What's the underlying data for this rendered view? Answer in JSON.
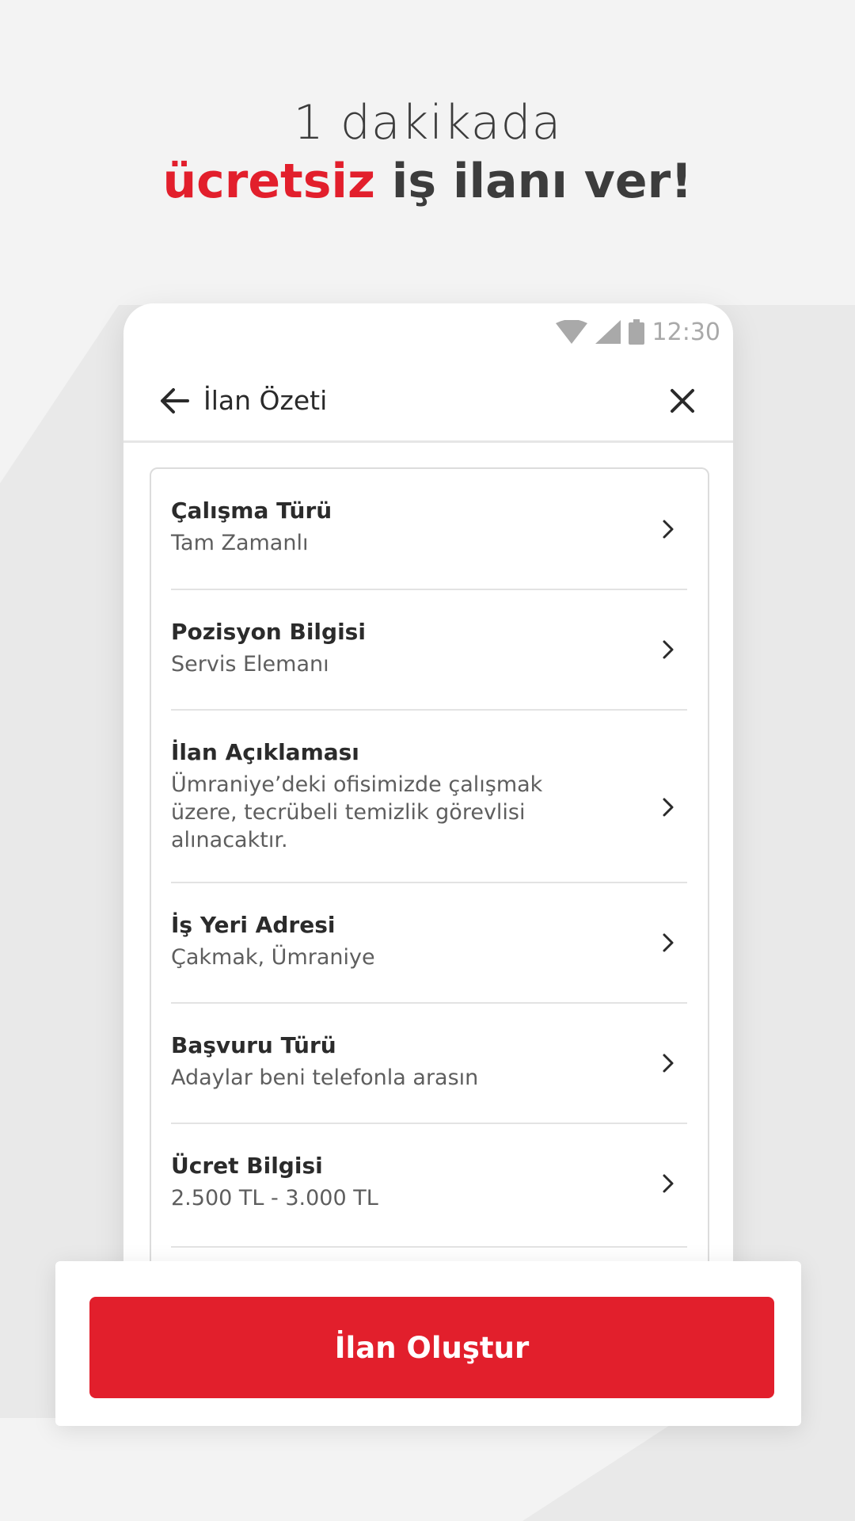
{
  "headline": {
    "line1": "1 dakikada",
    "line2_accent": "ücretsiz",
    "line2_rest": " iş ilanı ver!"
  },
  "statusbar": {
    "time": "12:30"
  },
  "appbar": {
    "title": "İlan Özeti"
  },
  "rows": [
    {
      "label": "Çalışma Türü",
      "value": "Tam Zamanlı"
    },
    {
      "label": "Pozisyon Bilgisi",
      "value": "Servis Elemanı"
    },
    {
      "label": "İlan Açıklaması",
      "value": "Ümraniye’deki ofisimizde çalışmak üzere, tecrübeli temizlik görevlisi alınacaktır."
    },
    {
      "label": "İş Yeri Adresi",
      "value": "Çakmak, Ümraniye"
    },
    {
      "label": "Başvuru Türü",
      "value": "Adaylar beni telefonla arasın"
    },
    {
      "label": "Ücret Bilgisi",
      "value": "2.500 TL - 3.000 TL"
    }
  ],
  "cta": {
    "label": "İlan Oluştur"
  },
  "colors": {
    "accent": "#e21f2c",
    "background": "#f3f3f3"
  },
  "icons": [
    "wifi-icon",
    "signal-icon",
    "battery-icon",
    "back-arrow-icon",
    "close-icon",
    "chevron-right-icon"
  ]
}
